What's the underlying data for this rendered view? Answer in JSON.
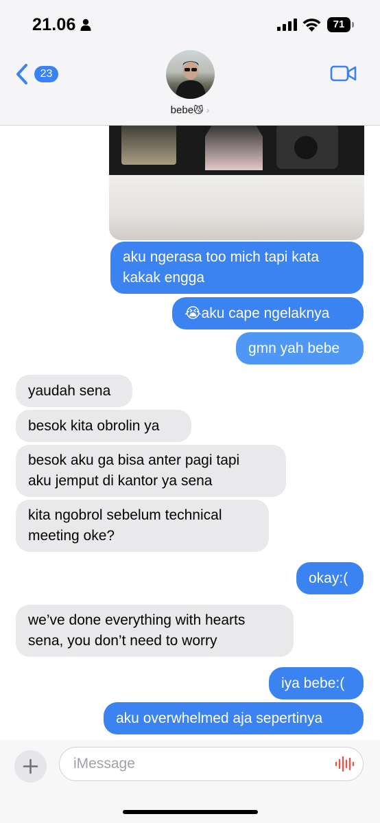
{
  "status_bar": {
    "time": "21.06",
    "battery_level": "71",
    "icons": [
      "person-icon",
      "cellular-signal-icon",
      "wifi-icon",
      "battery-icon"
    ]
  },
  "header": {
    "back_badge": "23",
    "contact_name": "bebe",
    "contact_emoji": "😼",
    "contact_chevron": "›",
    "icons": [
      "chevron-left-icon",
      "video-camera-icon"
    ]
  },
  "messages": [
    {
      "direction": "sent",
      "text": "aku ngerasa too mich tapi kata\nkakak engga"
    },
    {
      "direction": "sent",
      "text": "😭aku cape ngelaknya"
    },
    {
      "direction": "sent",
      "text": "gmn yah bebe"
    },
    {
      "direction": "received",
      "text": "yaudah sena"
    },
    {
      "direction": "received",
      "text": "besok kita obrolin ya"
    },
    {
      "direction": "received",
      "text": "besok aku ga bisa anter pagi tapi\naku jemput di kantor ya sena"
    },
    {
      "direction": "received",
      "text": "kita ngobrol sebelum technical\nmeeting oke?"
    },
    {
      "direction": "sent",
      "text": "okay:("
    },
    {
      "direction": "received",
      "text": "we’ve done everything with hearts\nsena, you don’t need to worry"
    },
    {
      "direction": "sent",
      "text": "iya bebe:("
    },
    {
      "direction": "sent",
      "text": "aku overwhelmed aja sepertinya"
    }
  ],
  "input_bar": {
    "placeholder": "iMessage",
    "icons": [
      "plus-icon",
      "audio-waveform-icon"
    ]
  },
  "colors": {
    "sent_bubble": "#3a83f0",
    "received_bubble": "#e9e9eb",
    "accent": "#3b82f6",
    "audio_icon": "#e8544a"
  }
}
